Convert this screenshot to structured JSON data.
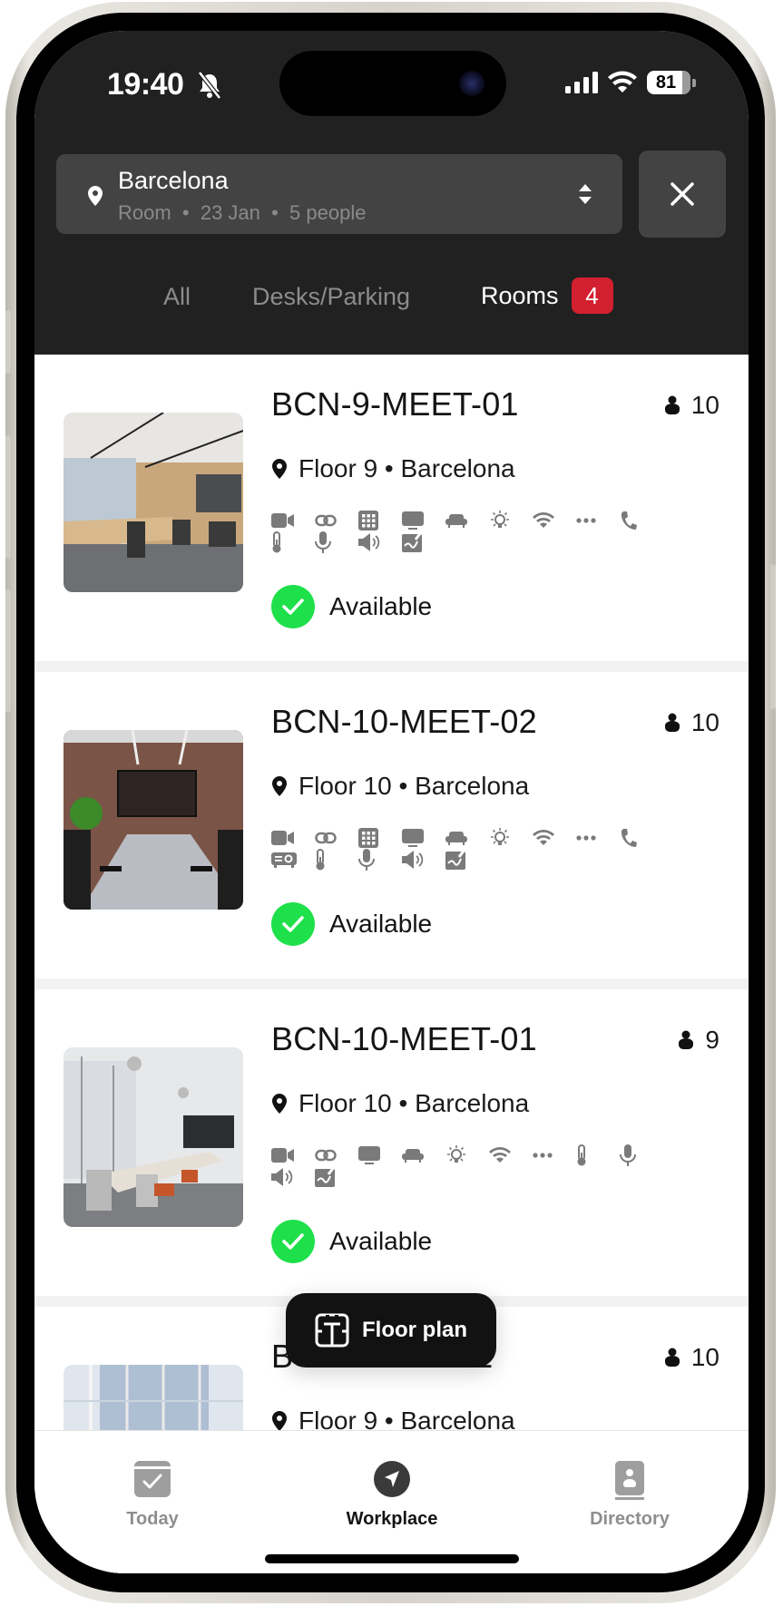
{
  "status_bar": {
    "time": "19:40",
    "silent_icon": "bell-slash-icon",
    "battery_percent": "81",
    "signal_icon": "cellular-signal-icon",
    "wifi_icon": "wifi-icon"
  },
  "search": {
    "location": "Barcelona",
    "summary": "Room  •  23 Jan  •  5 people",
    "location_icon": "location-pin-icon",
    "sort_icon": "sort-updown-icon",
    "close_icon": "close-icon"
  },
  "tabs": [
    {
      "label": "All",
      "active": false
    },
    {
      "label": "Desks/Parking",
      "active": false
    },
    {
      "label": "Rooms",
      "active": true,
      "badge": "4"
    }
  ],
  "accent_colors": {
    "badge": "#d32030",
    "available": "#1ee04a",
    "header_bg": "#212121"
  },
  "rooms": [
    {
      "name": "BCN-9-MEET-01",
      "capacity": "10",
      "location": "Floor 9 • Barcelona",
      "amenities": [
        "video-camera",
        "link",
        "keypad",
        "display",
        "sofa",
        "light-bulb",
        "wifi",
        "more",
        "phone",
        "thermometer",
        "microphone",
        "speaker",
        "whiteboard"
      ],
      "status": "Available"
    },
    {
      "name": "BCN-10-MEET-02",
      "capacity": "10",
      "location": "Floor 10 • Barcelona",
      "amenities": [
        "video-camera",
        "link",
        "keypad",
        "display",
        "sofa",
        "light-bulb",
        "wifi",
        "more",
        "phone",
        "projector",
        "thermometer",
        "microphone",
        "speaker",
        "whiteboard"
      ],
      "status": "Available"
    },
    {
      "name": "BCN-10-MEET-01",
      "capacity": "9",
      "location": "Floor 10 • Barcelona",
      "amenities": [
        "video-camera",
        "link",
        "display",
        "sofa",
        "light-bulb",
        "wifi",
        "more",
        "thermometer",
        "microphone",
        "speaker",
        "whiteboard"
      ],
      "status": "Available"
    },
    {
      "name_visible_start": "B",
      "name_visible_end": "2",
      "capacity": "10",
      "location": "Floor 9 • Barcelona"
    }
  ],
  "floor_plan_button": {
    "label": "Floor plan",
    "icon": "floor-plan-icon"
  },
  "bottom_nav": [
    {
      "label": "Today",
      "icon": "calendar-check-icon",
      "active": false
    },
    {
      "label": "Workplace",
      "icon": "navigation-arrow-icon",
      "active": true
    },
    {
      "label": "Directory",
      "icon": "contact-book-icon",
      "active": false
    }
  ]
}
